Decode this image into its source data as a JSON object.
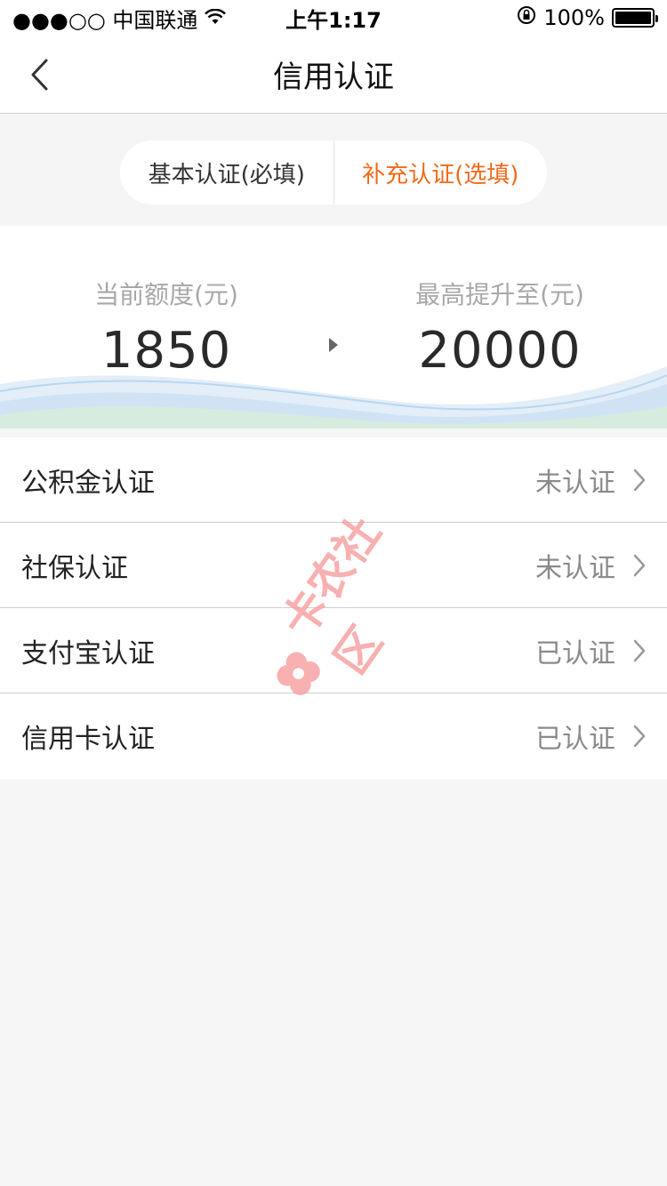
{
  "status_bar": {
    "carrier": "●●●○○ 中国联通",
    "time": "上午1:17",
    "battery": "100%"
  },
  "nav": {
    "title": "信用认证"
  },
  "tabs": [
    {
      "label": "基本认证(必填)"
    },
    {
      "label": "补充认证(选填)"
    }
  ],
  "credit": {
    "current_label": "当前额度(元)",
    "current_value": "1850",
    "max_label": "最高提升至(元)",
    "max_value": "20000"
  },
  "list": [
    {
      "label": "公积金认证",
      "status": "未认证"
    },
    {
      "label": "社保认证",
      "status": "未认证"
    },
    {
      "label": "支付宝认证",
      "status": "已认证"
    },
    {
      "label": "信用卡认证",
      "status": "已认证"
    }
  ],
  "watermark": {
    "text": "卡农社区"
  },
  "colors": {
    "accent": "#f06a1a",
    "muted": "#a8a8a8",
    "watermark": "#f7a3a3"
  },
  "icons": [
    "back-chevron-icon",
    "wifi-icon",
    "orientation-lock-icon",
    "battery-icon",
    "arrow-right-icon",
    "chevron-right-icon",
    "flower-logo-icon"
  ]
}
